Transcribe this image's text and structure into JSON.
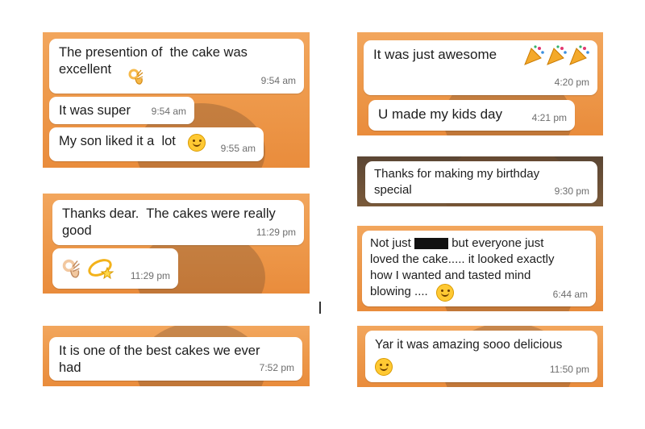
{
  "chats": [
    {
      "bubbles": [
        {
          "text": "The presention of  the cake was\nexcellent",
          "emoji": "ok-hand-icon",
          "time": "9:54 am"
        },
        {
          "text": "It was super",
          "time": "9:54 am"
        },
        {
          "text": "My son liked it a  lot",
          "emoji": "smiley-icon",
          "time": "9:55 am"
        }
      ]
    },
    {
      "bubbles": [
        {
          "text": "Thanks dear.  The cakes were really\ngood",
          "time": "11:29 pm"
        },
        {
          "emojis": [
            "ok-hand-icon",
            "dizzy-star-icon"
          ],
          "time": "11:29 pm"
        }
      ]
    },
    {
      "bubbles": [
        {
          "text": "It is one of the best cakes we ever\nhad",
          "time": "7:52 pm"
        }
      ]
    },
    {
      "bubbles": [
        {
          "text": "It was just awesome",
          "emoji": "party-popper-icon",
          "time": "4:20 pm"
        },
        {
          "text": "U made my kids day",
          "time": "4:21 pm"
        }
      ]
    },
    {
      "bubbles": [
        {
          "text": "Thanks for making my birthday\nspecial",
          "time": "9:30 pm"
        }
      ]
    },
    {
      "bubbles": [
        {
          "text_before": "Not just",
          "text_after": "but everyone just\nloved the cake..... it looked exactly\nhow I wanted and tasted mind\nblowing ....",
          "emoji": "yum-face-icon",
          "time": "6:44 am"
        }
      ]
    },
    {
      "bubbles": [
        {
          "text": "Yar it was amazing sooo delicious",
          "emoji": "blush-icon",
          "time": "11:50 pm"
        }
      ]
    }
  ]
}
